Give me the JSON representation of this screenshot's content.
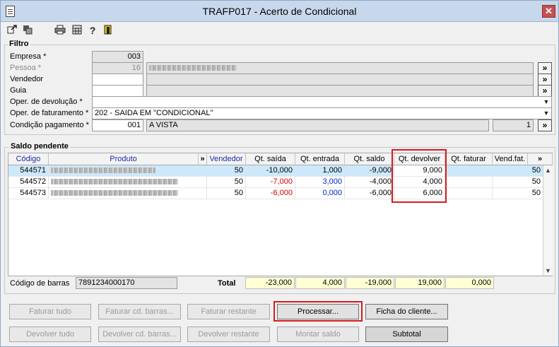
{
  "window": {
    "title": "TRAFP017 - Acerto de Condicional",
    "close": "✕"
  },
  "toolbar": {
    "icons": [
      "exit-icon",
      "refresh-icon",
      "print-icon",
      "calculator-icon",
      "help-icon",
      "door-icon"
    ]
  },
  "filtro": {
    "title": "Filtro",
    "empresa": {
      "label": "Empresa *",
      "value": "003"
    },
    "pessoa": {
      "label": "Pessoa *",
      "value": "16"
    },
    "vendedor": {
      "label": "Vendedor"
    },
    "guia": {
      "label": "Guia"
    },
    "oper_devolucao": {
      "label": "Oper. de devolução *",
      "value": ""
    },
    "oper_faturamento": {
      "label": "Oper. de faturamento *",
      "value": "202 - SAIDA EM \"CONDICIONAL\""
    },
    "condicao": {
      "label": "Condição pagamento *",
      "code": "001",
      "value": "A VISTA",
      "parcelas": "1"
    },
    "more_label": "»"
  },
  "saldo": {
    "title": "Saldo pendente",
    "columns": [
      "Código",
      "Produto",
      "»",
      "Vendedor",
      "Qt. saída",
      "Qt. entrada",
      "Qt. saldo",
      "Qt. devolver",
      "Qt. faturar",
      "Vend.fat.",
      "»"
    ],
    "rows": [
      {
        "codigo": "544571",
        "vendedor": "50",
        "saida": "-10,000",
        "entrada": "1,000",
        "saldo": "-9,000",
        "devolver": "9,000",
        "faturar": "",
        "vendfat": "50"
      },
      {
        "codigo": "544572",
        "vendedor": "50",
        "saida": "-7,000",
        "entrada": "3,000",
        "saldo": "-4,000",
        "devolver": "4,000",
        "faturar": "",
        "vendfat": "50"
      },
      {
        "codigo": "544573",
        "vendedor": "50",
        "saida": "-6,000",
        "entrada": "0,000",
        "saldo": "-6,000",
        "devolver": "6,000",
        "faturar": "",
        "vendfat": "50"
      }
    ],
    "barcode_label": "Código de barras",
    "barcode_value": "7891234000170",
    "total_label": "Total",
    "totals": {
      "saida": "-23,000",
      "entrada": "4,000",
      "saldo": "-19,000",
      "devolver": "19,000",
      "faturar": "0,000"
    }
  },
  "buttons": {
    "faturar_tudo": "Faturar tudo",
    "faturar_cd": "Faturar cd. barras...",
    "faturar_restante": "Faturar restante",
    "processar": "Processar...",
    "ficha": "Ficha do cliente...",
    "devolver_tudo": "Devolver tudo",
    "devolver_cd": "Devolver cd. barras...",
    "devolver_restante": "Devolver restante",
    "montar_saldo": "Montar saldo",
    "subtotal": "Subtotal"
  },
  "colors": {
    "highlight": "#d41c1c",
    "total_bg": "#ffffd4",
    "selected_row": "#cde8fb"
  }
}
